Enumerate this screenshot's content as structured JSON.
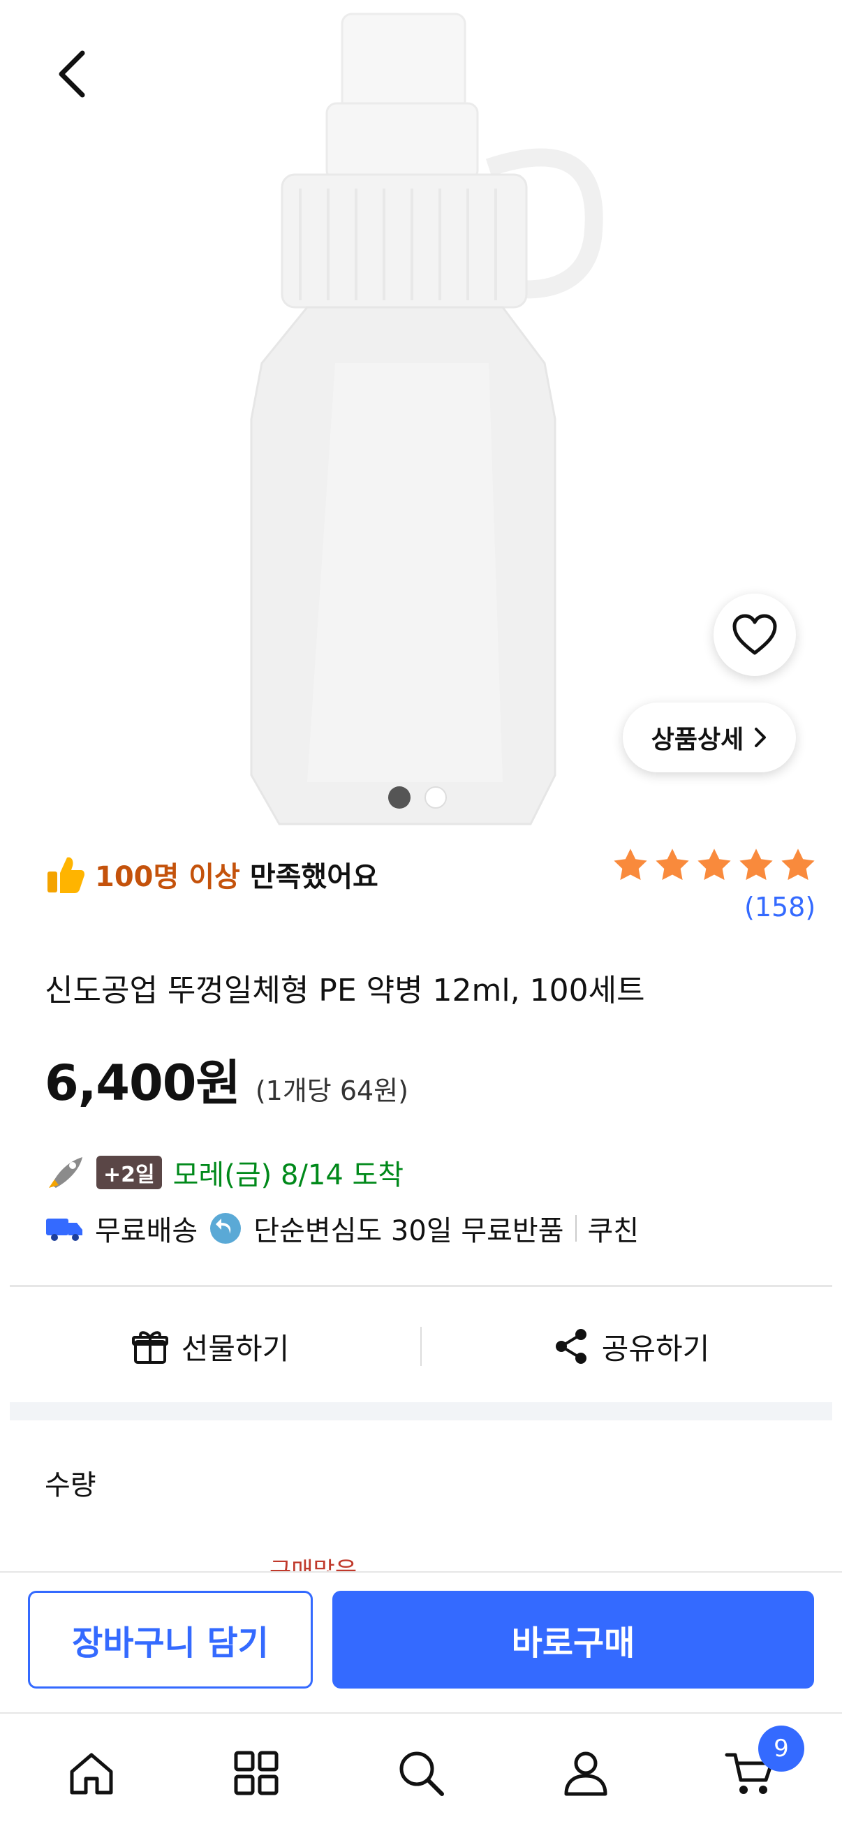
{
  "product": {
    "image_dots": {
      "total": 2,
      "active_index": 1
    },
    "detail_button_label": "상품상세",
    "satisfaction": {
      "highlight": "100명 이상",
      "rest": "만족했어요"
    },
    "rating": {
      "stars": 5,
      "count_label": "(158)"
    },
    "title": "신도공업 뚜껑일체형 PE 약병 12ml, 100세트",
    "price": "6,400원",
    "unit_price": "(1개당 64원)",
    "delivery": {
      "badge": "+2일",
      "arrival": "모레(금) 8/14 도착",
      "free_shipping": "무료배송",
      "free_return": "단순변심도 30일 무료반품",
      "seller": "쿠친"
    }
  },
  "actions": {
    "gift_label": "선물하기",
    "share_label": "공유하기"
  },
  "quantity": {
    "label": "수량",
    "partial_text": "구매많음"
  },
  "buy_bar": {
    "cart_label": "장바구니 담기",
    "buy_label": "바로구매"
  },
  "tabbar": {
    "items": [
      "home-icon",
      "category-icon",
      "search-icon",
      "account-icon",
      "cart-icon"
    ],
    "cart_badge": "9"
  },
  "colors": {
    "accent": "#346aff",
    "satisfaction_highlight": "#c4520b",
    "arrival_green": "#00891a",
    "star": "#f98a3c"
  }
}
